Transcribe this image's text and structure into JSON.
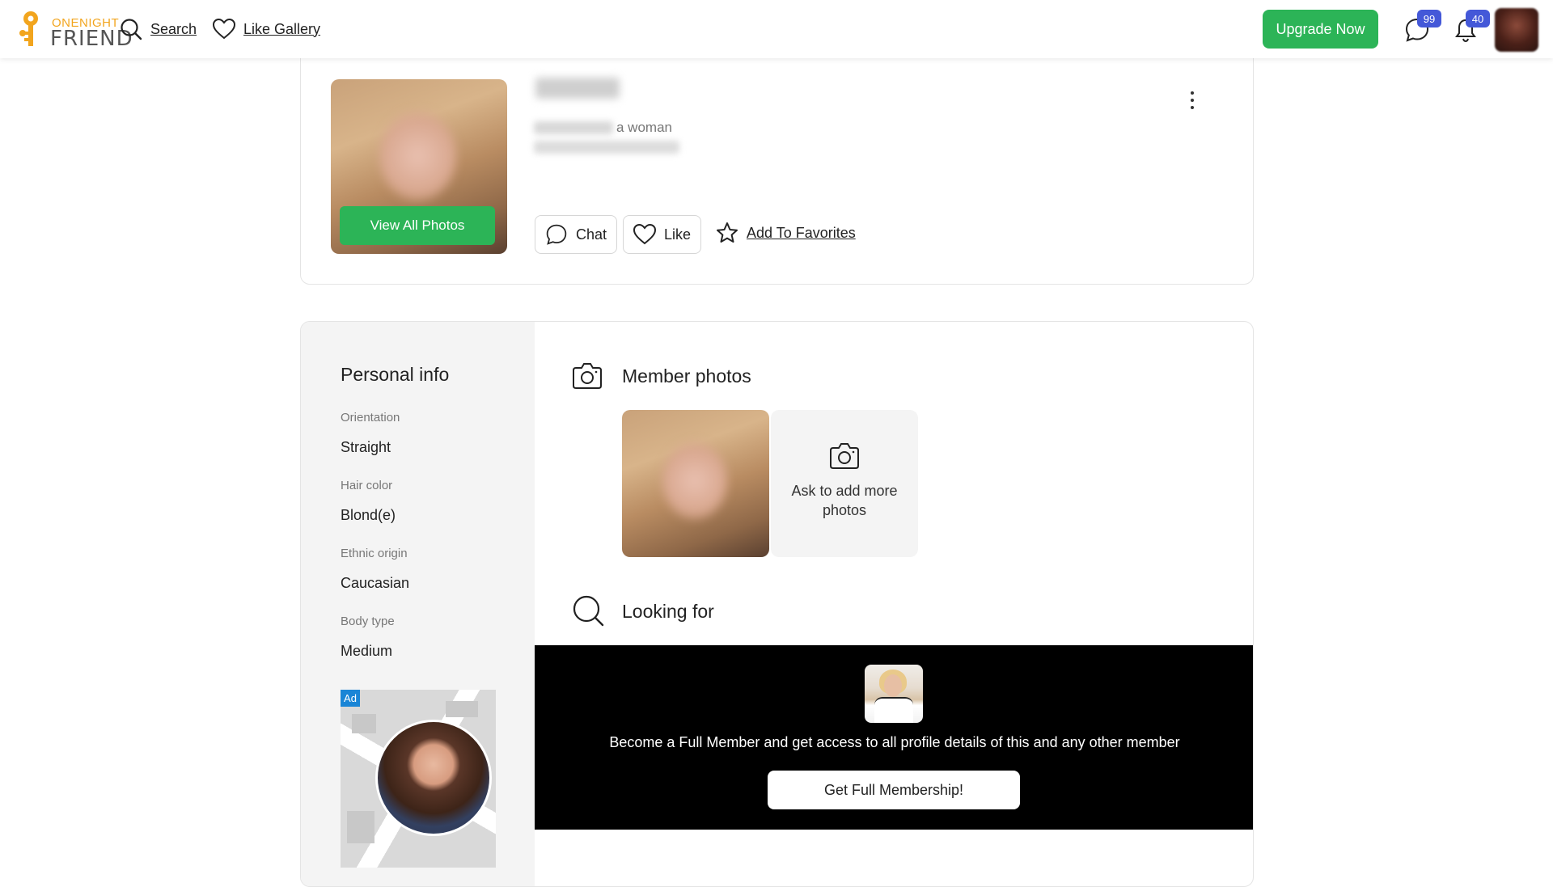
{
  "header": {
    "logo_top_a": "ONE",
    "logo_top_b": "NIGHT",
    "logo_bottom": "FRIEND",
    "search_label": "Search",
    "like_gallery_label": "Like Gallery",
    "upgrade_label": "Upgrade Now",
    "messages_count": "99",
    "notifications_count": "40"
  },
  "profile": {
    "seeking_text": "a woman",
    "view_all_photos_label": "View All Photos",
    "chat_label": "Chat",
    "like_label": "Like",
    "favorites_label": "Add To Favorites"
  },
  "personal_info": {
    "title": "Personal info",
    "fields": [
      {
        "label": "Orientation",
        "value": "Straight"
      },
      {
        "label": "Hair color",
        "value": "Blond(e)"
      },
      {
        "label": "Ethnic origin",
        "value": "Caucasian"
      },
      {
        "label": "Body type",
        "value": "Medium"
      }
    ],
    "ad_tag": "Ad"
  },
  "member_photos": {
    "title": "Member photos",
    "ask_text": "Ask to add more photos"
  },
  "looking_for": {
    "title": "Looking for"
  },
  "promo": {
    "text": "Become a Full Member and get access to all profile details of this and any other member",
    "button_label": "Get Full Membership!"
  },
  "colors": {
    "accent_green": "#2cb457",
    "badge_blue": "#4458d8",
    "logo_orange": "#f2a51e"
  },
  "icons": [
    "key-logo-icon",
    "search-icon",
    "heart-icon",
    "chat-bubble-icon",
    "bell-icon",
    "kebab-menu-icon",
    "star-icon",
    "camera-icon"
  ]
}
